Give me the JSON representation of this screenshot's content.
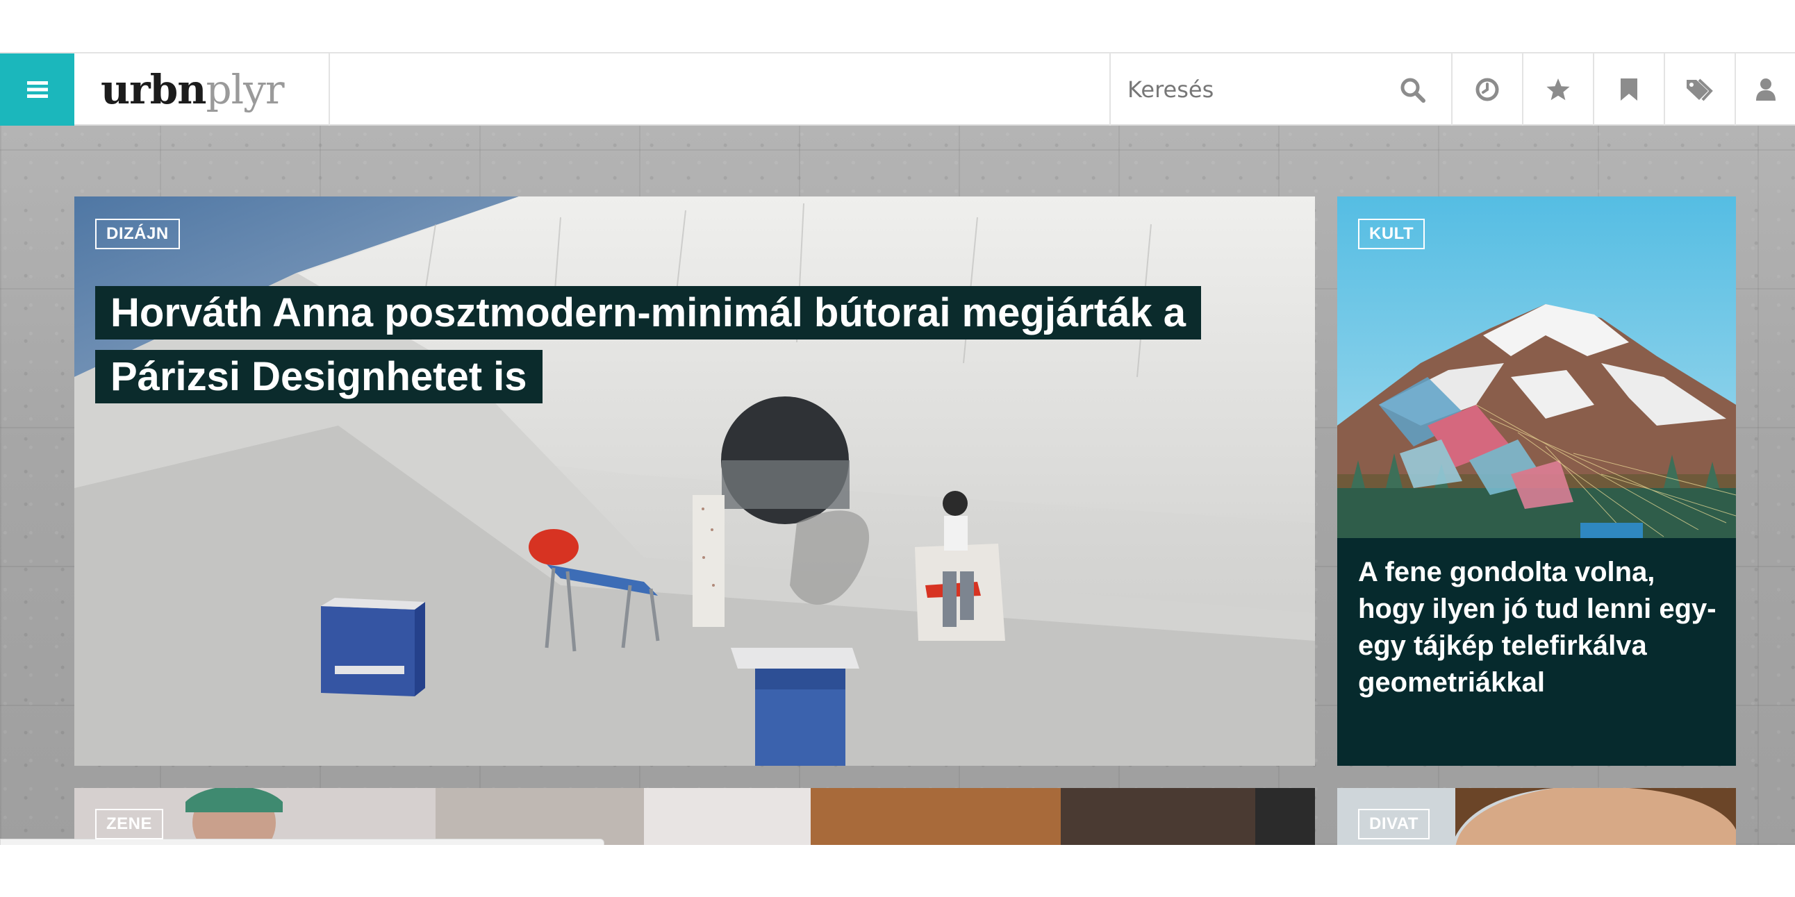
{
  "header": {
    "logo_dark": "urbn",
    "logo_light": "plyr",
    "search_placeholder": "Keresés",
    "icons": [
      "menu-icon",
      "search-icon",
      "clock-icon",
      "star-icon",
      "bookmark-icon",
      "tag-icon",
      "user-icon"
    ]
  },
  "colors": {
    "accent": "#1bb7bc",
    "headline_bg": "#0b2b2c",
    "side_card_bg": "#062a2d"
  },
  "featured": {
    "category": "DIZÁJN",
    "title": "Horváth Anna posztmodern-minimál bútorai megjárták a Párizsi Designhetet is"
  },
  "side": {
    "category": "KULT",
    "title": "A fene gondolta volna, hogy ilyen jó tud lenni egy-egy tájkép telefirkálva geometriákkal"
  },
  "bottom_cards": [
    {
      "category": "ZENE"
    },
    {
      "category": "DIVAT"
    }
  ]
}
